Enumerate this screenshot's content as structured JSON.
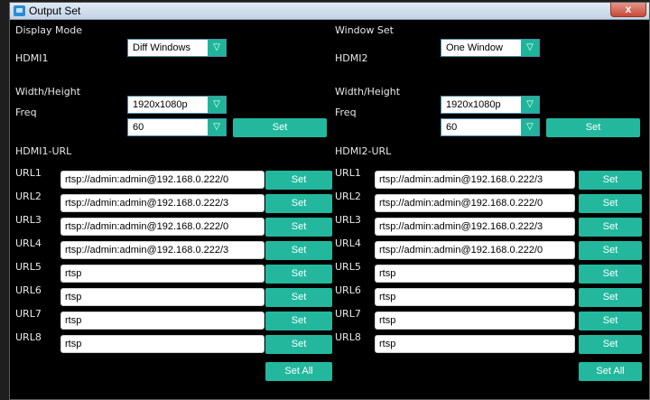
{
  "window": {
    "title": "Output Set",
    "close_label": "x"
  },
  "display_mode": {
    "label": "Display Mode",
    "value": "Diff Windows",
    "arrow": "▽"
  },
  "window_set": {
    "label": "Window Set",
    "value": "One Window",
    "arrow": "▽"
  },
  "hdmi1": {
    "title": "HDMI1",
    "width_height_label": "Width/Height",
    "resolution": "1920x1080p",
    "freq_label": "Freq",
    "freq": "60",
    "set_label": "Set"
  },
  "hdmi2": {
    "title": "HDMI2",
    "width_height_label": "Width/Height",
    "resolution": "1920x1080p",
    "freq_label": "Freq",
    "freq": "60",
    "set_label": "Set"
  },
  "hdmi1_url": {
    "title": "HDMI1-URL",
    "set_all_label": "Set All",
    "rows": [
      {
        "label": "URL1",
        "value": "rtsp://admin:admin@192.168.0.222/0",
        "button": "Set"
      },
      {
        "label": "URL2",
        "value": "rtsp://admin:admin@192.168.0.222/3",
        "button": "Set"
      },
      {
        "label": "URL3",
        "value": "rtsp://admin:admin@192.168.0.222/0",
        "button": "Set"
      },
      {
        "label": "URL4",
        "value": "rtsp://admin:admin@192.168.0.222/3",
        "button": "Set"
      },
      {
        "label": "URL5",
        "value": "rtsp",
        "button": "Set"
      },
      {
        "label": "URL6",
        "value": "rtsp",
        "button": "Set"
      },
      {
        "label": "URL7",
        "value": "rtsp",
        "button": "Set"
      },
      {
        "label": "URL8",
        "value": "rtsp",
        "button": "Set"
      }
    ]
  },
  "hdmi2_url": {
    "title": "HDMI2-URL",
    "set_all_label": "Set All",
    "rows": [
      {
        "label": "URL1",
        "value": "rtsp://admin:admin@192.168.0.222/3",
        "button": "Set"
      },
      {
        "label": "URL2",
        "value": "rtsp://admin:admin@192.168.0.222/0",
        "button": "Set"
      },
      {
        "label": "URL3",
        "value": "rtsp://admin:admin@192.168.0.222/3",
        "button": "Set"
      },
      {
        "label": "URL4",
        "value": "rtsp://admin:admin@192.168.0.222/0",
        "button": "Set"
      },
      {
        "label": "URL5",
        "value": "rtsp",
        "button": "Set"
      },
      {
        "label": "URL6",
        "value": "rtsp",
        "button": "Set"
      },
      {
        "label": "URL7",
        "value": "rtsp",
        "button": "Set"
      },
      {
        "label": "URL8",
        "value": "rtsp",
        "button": "Set"
      }
    ]
  },
  "colors": {
    "accent": "#23b89e",
    "background": "#000000",
    "titlebar": "#c4d3e6",
    "close": "#c84a37"
  }
}
